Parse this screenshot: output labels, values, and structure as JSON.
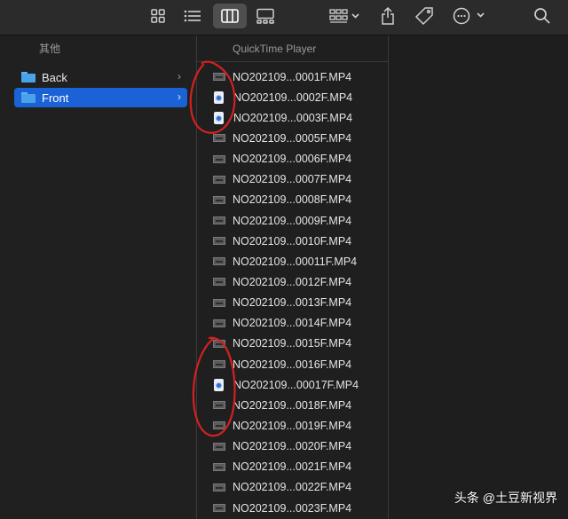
{
  "toolbar": {
    "buttons": [
      {
        "name": "view-icons-button",
        "icon": "grid-icon"
      },
      {
        "name": "view-list-button",
        "icon": "list-icon"
      },
      {
        "name": "view-columns-button",
        "icon": "columns-icon",
        "selected": true
      },
      {
        "name": "view-gallery-button",
        "icon": "gallery-icon"
      },
      {
        "name": "group-button",
        "icon": "group-grid-icon"
      },
      {
        "name": "share-button",
        "icon": "share-icon"
      },
      {
        "name": "tag-button",
        "icon": "tag-icon"
      },
      {
        "name": "more-button",
        "icon": "ellipsis-icon"
      },
      {
        "name": "search-button",
        "icon": "search-icon"
      }
    ]
  },
  "columns": {
    "left": {
      "header": "其他",
      "items": [
        {
          "label": "Back",
          "chevron": "›",
          "selected": false
        },
        {
          "label": "Front",
          "chevron": "›",
          "selected": true
        }
      ]
    },
    "middle": {
      "header": "QuickTime Player",
      "files": [
        {
          "name": "NO202109...0001F.MP4",
          "icon": "video-thumbnail"
        },
        {
          "name": "NO202109...0002F.MP4",
          "icon": "quicktime-document"
        },
        {
          "name": "NO202109...0003F.MP4",
          "icon": "quicktime-document"
        },
        {
          "name": "NO202109...0005F.MP4",
          "icon": "video-thumbnail"
        },
        {
          "name": "NO202109...0006F.MP4",
          "icon": "video-thumbnail"
        },
        {
          "name": "NO202109...0007F.MP4",
          "icon": "video-thumbnail"
        },
        {
          "name": "NO202109...0008F.MP4",
          "icon": "video-thumbnail"
        },
        {
          "name": "NO202109...0009F.MP4",
          "icon": "video-thumbnail"
        },
        {
          "name": "NO202109...0010F.MP4",
          "icon": "video-thumbnail"
        },
        {
          "name": "NO202109...00011F.MP4",
          "icon": "video-thumbnail"
        },
        {
          "name": "NO202109...0012F.MP4",
          "icon": "video-thumbnail"
        },
        {
          "name": "NO202109...0013F.MP4",
          "icon": "video-thumbnail"
        },
        {
          "name": "NO202109...0014F.MP4",
          "icon": "video-thumbnail"
        },
        {
          "name": "NO202109...0015F.MP4",
          "icon": "video-thumbnail"
        },
        {
          "name": "NO202109...0016F.MP4",
          "icon": "video-thumbnail"
        },
        {
          "name": "NO202109...00017F.MP4",
          "icon": "quicktime-document"
        },
        {
          "name": "NO202109...0018F.MP4",
          "icon": "video-thumbnail"
        },
        {
          "name": "NO202109...0019F.MP4",
          "icon": "video-thumbnail"
        },
        {
          "name": "NO202109...0020F.MP4",
          "icon": "video-thumbnail"
        },
        {
          "name": "NO202109...0021F.MP4",
          "icon": "video-thumbnail"
        },
        {
          "name": "NO202109...0022F.MP4",
          "icon": "video-thumbnail"
        },
        {
          "name": "NO202109...0023F.MP4",
          "icon": "video-thumbnail"
        }
      ]
    }
  },
  "watermark": {
    "text": "头条 @土豆新视界"
  },
  "colors": {
    "selection": "#1b62d6",
    "annotation": "#d42020",
    "folder": "#4aa3ea"
  }
}
